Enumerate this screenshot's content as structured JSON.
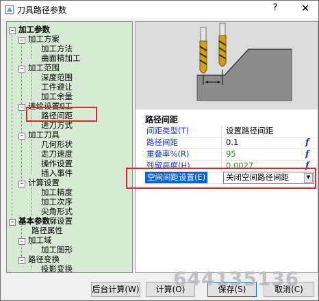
{
  "window": {
    "title": "刀具路径参数",
    "help_glyph": "?",
    "close_glyph": "✕"
  },
  "tree": {
    "nodes": [
      {
        "label": "加工参数",
        "bold": true,
        "expander": "−"
      },
      {
        "label": "加工方案",
        "expander": "−"
      },
      {
        "label": "加工方法"
      },
      {
        "label": "曲面精加工"
      },
      {
        "label": "加工范围",
        "expander": "−"
      },
      {
        "label": "深度范围"
      },
      {
        "label": "工件避让"
      },
      {
        "label": "加工余量"
      },
      {
        "label": "电极加工"
      },
      {
        "label": "进给设置",
        "expander": "−"
      },
      {
        "label": "路径间距"
      },
      {
        "label": "进刀方式"
      },
      {
        "label": "加工刀具",
        "expander": "−"
      },
      {
        "label": "几何形状"
      },
      {
        "label": "走刀速度"
      },
      {
        "label": "操作设置"
      },
      {
        "label": "插入事件"
      },
      {
        "label": "计算设置",
        "expander": "−"
      },
      {
        "label": "加工精度"
      },
      {
        "label": "加工次序"
      },
      {
        "label": "尖角形式"
      },
      {
        "label": "轮廓设置"
      },
      {
        "label": "基本参数",
        "bold": true,
        "expander": "−"
      },
      {
        "label": "路径属性"
      },
      {
        "label": "加工域",
        "expander": "−"
      },
      {
        "label": "加工图形"
      },
      {
        "label": "路径变换",
        "expander": "−"
      },
      {
        "label": "投影变换"
      }
    ]
  },
  "panel": {
    "title": "路径间距",
    "rows": [
      {
        "name": "间距类型(T)",
        "value": "设置路径间距",
        "fx": ""
      },
      {
        "name": "路径间距",
        "value": "0.1",
        "fx": "f"
      },
      {
        "name": "重叠率%(R)",
        "value": "95",
        "fx": "f"
      },
      {
        "name": "残留高度(H)",
        "value": "0.0027",
        "fx": "f"
      },
      {
        "name": "空间间距设置(E)",
        "value": "关闭空间路径间距",
        "fx": ""
      }
    ]
  },
  "buttons": {
    "background_calc": "后台计算(W)",
    "calc": "计算(O)",
    "save": "保存(S)",
    "cancel": "取消(C)"
  },
  "watermark": "644135136",
  "colors": {
    "tree_bg": "#d7ead4",
    "highlight_red": "#e0262b",
    "select_blue": "#0a64d6",
    "param_blue": "#1a36c8",
    "value_green": "#2d8a2d"
  }
}
